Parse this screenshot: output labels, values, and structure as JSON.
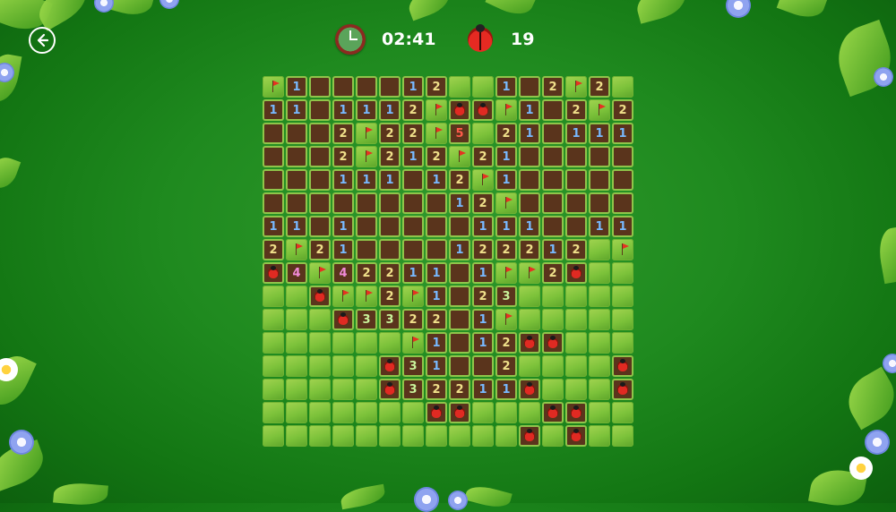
{
  "hud": {
    "timer": "02:41",
    "mines_remaining": "19"
  },
  "icons": {
    "back": "back-arrow-icon",
    "clock": "clock-icon",
    "mine": "ladybug-icon"
  },
  "colors": {
    "background": "#1f8a1f",
    "unrevealed_tile": "#7cc23a",
    "revealed_tile": "#5a341c",
    "flag": "#e63222"
  },
  "legend": "Cell codes: G = unrevealed grass, F = flag, B = ladybug (mine), R = revealed empty, digits = revealed count",
  "board": {
    "rows": 16,
    "cols": 16,
    "cells": [
      [
        "F",
        "1",
        "R",
        "R",
        "R",
        "R",
        "1",
        "2",
        "G",
        "G",
        "1",
        "R",
        "2",
        "F",
        "2",
        "G"
      ],
      [
        "1",
        "1",
        "R",
        "1",
        "1",
        "1",
        "2",
        "F",
        "B",
        "B",
        "F",
        "1",
        "R",
        "2",
        "F",
        "2"
      ],
      [
        "R",
        "R",
        "R",
        "2",
        "F",
        "2",
        "2",
        "F",
        "5",
        "G",
        "2",
        "1",
        "R",
        "1",
        "1",
        "1"
      ],
      [
        "R",
        "R",
        "R",
        "2",
        "F",
        "2",
        "1",
        "2",
        "F",
        "2",
        "1",
        "R",
        "R",
        "R",
        "R",
        "R"
      ],
      [
        "R",
        "R",
        "R",
        "1",
        "1",
        "1",
        "R",
        "1",
        "2",
        "F",
        "1",
        "R",
        "R",
        "R",
        "R",
        "R"
      ],
      [
        "R",
        "R",
        "R",
        "R",
        "R",
        "R",
        "R",
        "R",
        "1",
        "2",
        "F",
        "R",
        "R",
        "R",
        "R",
        "R"
      ],
      [
        "1",
        "1",
        "R",
        "1",
        "R",
        "R",
        "R",
        "R",
        "R",
        "1",
        "1",
        "1",
        "R",
        "R",
        "1",
        "1"
      ],
      [
        "2",
        "F",
        "2",
        "1",
        "R",
        "R",
        "R",
        "R",
        "1",
        "2",
        "2",
        "2",
        "1",
        "2",
        "G",
        "F"
      ],
      [
        "B",
        "4",
        "F",
        "4",
        "2",
        "2",
        "1",
        "1",
        "R",
        "1",
        "F",
        "F",
        "2",
        "B",
        "G",
        "G"
      ],
      [
        "G",
        "G",
        "B",
        "F",
        "F",
        "2",
        "F",
        "1",
        "R",
        "2",
        "3",
        "G",
        "G",
        "G",
        "G",
        "G"
      ],
      [
        "G",
        "G",
        "G",
        "B",
        "3",
        "3",
        "2",
        "2",
        "R",
        "1",
        "F",
        "G",
        "G",
        "G",
        "G",
        "G"
      ],
      [
        "G",
        "G",
        "G",
        "G",
        "G",
        "G",
        "F",
        "1",
        "R",
        "1",
        "2",
        "B",
        "B",
        "G",
        "G",
        "G"
      ],
      [
        "G",
        "G",
        "G",
        "G",
        "G",
        "B",
        "3",
        "1",
        "R",
        "R",
        "2",
        "G",
        "G",
        "G",
        "G",
        "B"
      ],
      [
        "G",
        "G",
        "G",
        "G",
        "G",
        "B",
        "3",
        "2",
        "2",
        "1",
        "1",
        "B",
        "G",
        "G",
        "G",
        "B"
      ],
      [
        "G",
        "G",
        "G",
        "G",
        "G",
        "G",
        "G",
        "B",
        "B",
        "G",
        "G",
        "G",
        "B",
        "B",
        "G",
        "G"
      ],
      [
        "G",
        "G",
        "G",
        "G",
        "G",
        "G",
        "G",
        "G",
        "G",
        "G",
        "G",
        "B",
        "G",
        "B",
        "G",
        "G"
      ]
    ]
  }
}
